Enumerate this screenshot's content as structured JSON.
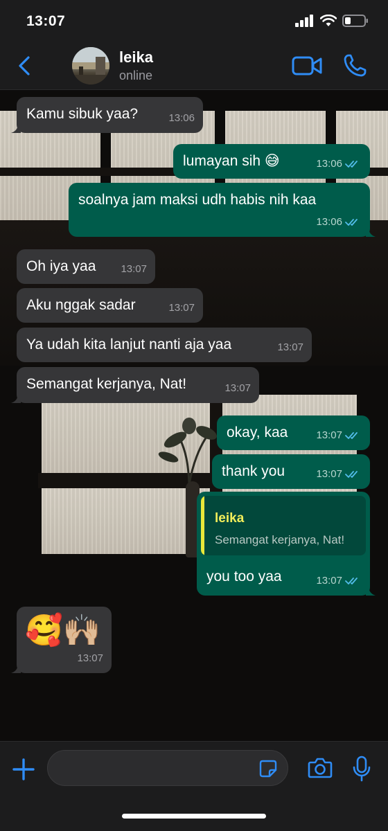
{
  "status_bar": {
    "time": "13:07"
  },
  "header": {
    "contact_name": "leika",
    "contact_status": "online",
    "accent_color": "#2f8cf5"
  },
  "messages": [
    {
      "direction": "incoming",
      "text": "Kamu sibuk yaa?",
      "time": "13:06"
    },
    {
      "direction": "outgoing",
      "text": "lumayan sih 😅",
      "time": "13:06",
      "read": true
    },
    {
      "direction": "outgoing",
      "text": "soalnya jam maksi udh habis nih kaa",
      "time": "13:06",
      "read": true
    },
    {
      "direction": "incoming",
      "text": "Oh iya yaa",
      "time": "13:07"
    },
    {
      "direction": "incoming",
      "text": "Aku nggak sadar",
      "time": "13:07"
    },
    {
      "direction": "incoming",
      "text": "Ya udah kita lanjut nanti aja yaa",
      "time": "13:07"
    },
    {
      "direction": "incoming",
      "text": "Semangat kerjanya, Nat!",
      "time": "13:07"
    },
    {
      "direction": "outgoing",
      "text": "okay, kaa",
      "time": "13:07",
      "read": true
    },
    {
      "direction": "outgoing",
      "text": "thank you",
      "time": "13:07",
      "read": true
    },
    {
      "direction": "outgoing",
      "text": "you too yaa",
      "time": "13:07",
      "read": true,
      "reply_to": {
        "name": "leika",
        "text": "Semangat kerjanya, Nat!"
      }
    },
    {
      "direction": "incoming",
      "text": "🥰🙌🏼",
      "time": "13:07",
      "emoji_only": true
    }
  ],
  "input_bar": {
    "placeholder": ""
  },
  "colors": {
    "incoming_bubble": "#363638",
    "outgoing_bubble": "#005c4b",
    "read_ticks": "#53bdeb",
    "reply_name": "#f2ee5a"
  },
  "icons": {
    "back": "chevron-left-icon",
    "video": "video-camera-icon",
    "call": "phone-icon",
    "attach": "plus-icon",
    "sticker": "sticker-icon",
    "camera": "camera-icon",
    "mic": "microphone-icon"
  }
}
